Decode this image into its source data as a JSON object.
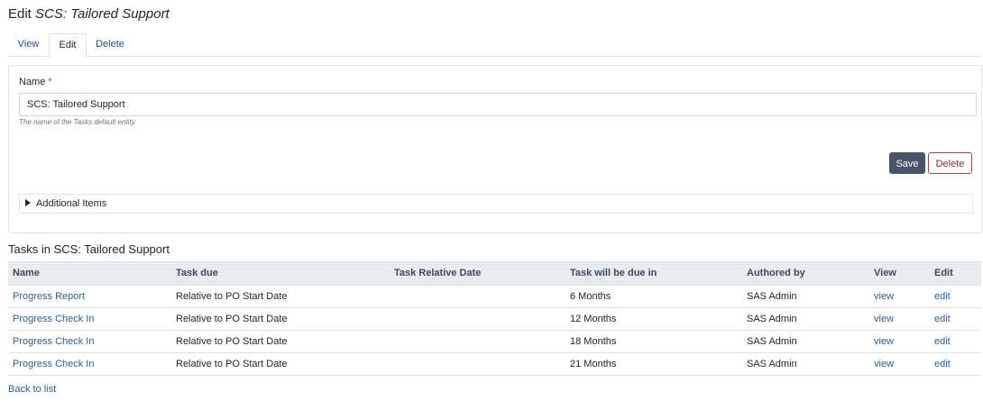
{
  "page": {
    "title_prefix": "Edit",
    "title_entity": "SCS: Tailored Support"
  },
  "tabs": [
    {
      "label": "View",
      "active": false
    },
    {
      "label": "Edit",
      "active": true
    },
    {
      "label": "Delete",
      "active": false
    }
  ],
  "form": {
    "name_label": "Name",
    "required_mark": "*",
    "name_value": "SCS: Tailored Support",
    "help_text": "The name of the Tasks default entity.",
    "save_label": "Save",
    "delete_label": "Delete",
    "additional_items_label": "Additional Items"
  },
  "tasks": {
    "title": "Tasks in SCS: Tailored Support",
    "columns": [
      "Name",
      "Task due",
      "Task Relative Date",
      "Task will be due in",
      "Authored by",
      "View",
      "Edit"
    ],
    "rows": [
      {
        "name": "Progress Report",
        "due": "Relative to PO Start Date",
        "relative_date": "",
        "due_in": "6 Months",
        "author": "SAS Admin",
        "view": "view",
        "edit": "edit"
      },
      {
        "name": "Progress Check In",
        "due": "Relative to PO Start Date",
        "relative_date": "",
        "due_in": "12 Months",
        "author": "SAS Admin",
        "view": "view",
        "edit": "edit"
      },
      {
        "name": "Progress Check In",
        "due": "Relative to PO Start Date",
        "relative_date": "",
        "due_in": "18 Months",
        "author": "SAS Admin",
        "view": "view",
        "edit": "edit"
      },
      {
        "name": "Progress Check In",
        "due": "Relative to PO Start Date",
        "relative_date": "",
        "due_in": "21 Months",
        "author": "SAS Admin",
        "view": "view",
        "edit": "edit"
      }
    ]
  },
  "footer": {
    "back_label": "Back to list"
  },
  "colors": {
    "primary_button": "#4a5469",
    "danger_border": "#a94442",
    "link": "#2c5e8f",
    "table_header_bg": "#e9ecef"
  }
}
